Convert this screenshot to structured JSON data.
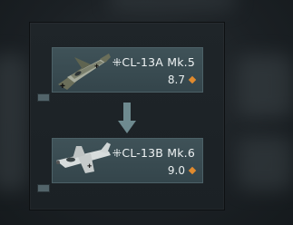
{
  "tree": {
    "top": {
      "name": "⁜CL-13A Mk.5",
      "br": "8.7",
      "icon": "jet-fighter-camo-icon",
      "diamond_color": "#e08a2e"
    },
    "bottom": {
      "name": "⁜CL-13B Mk.6",
      "br": "9.0",
      "icon": "jet-fighter-silver-icon",
      "diamond_color": "#e08a2e"
    },
    "connector": "down-arrow-icon"
  }
}
